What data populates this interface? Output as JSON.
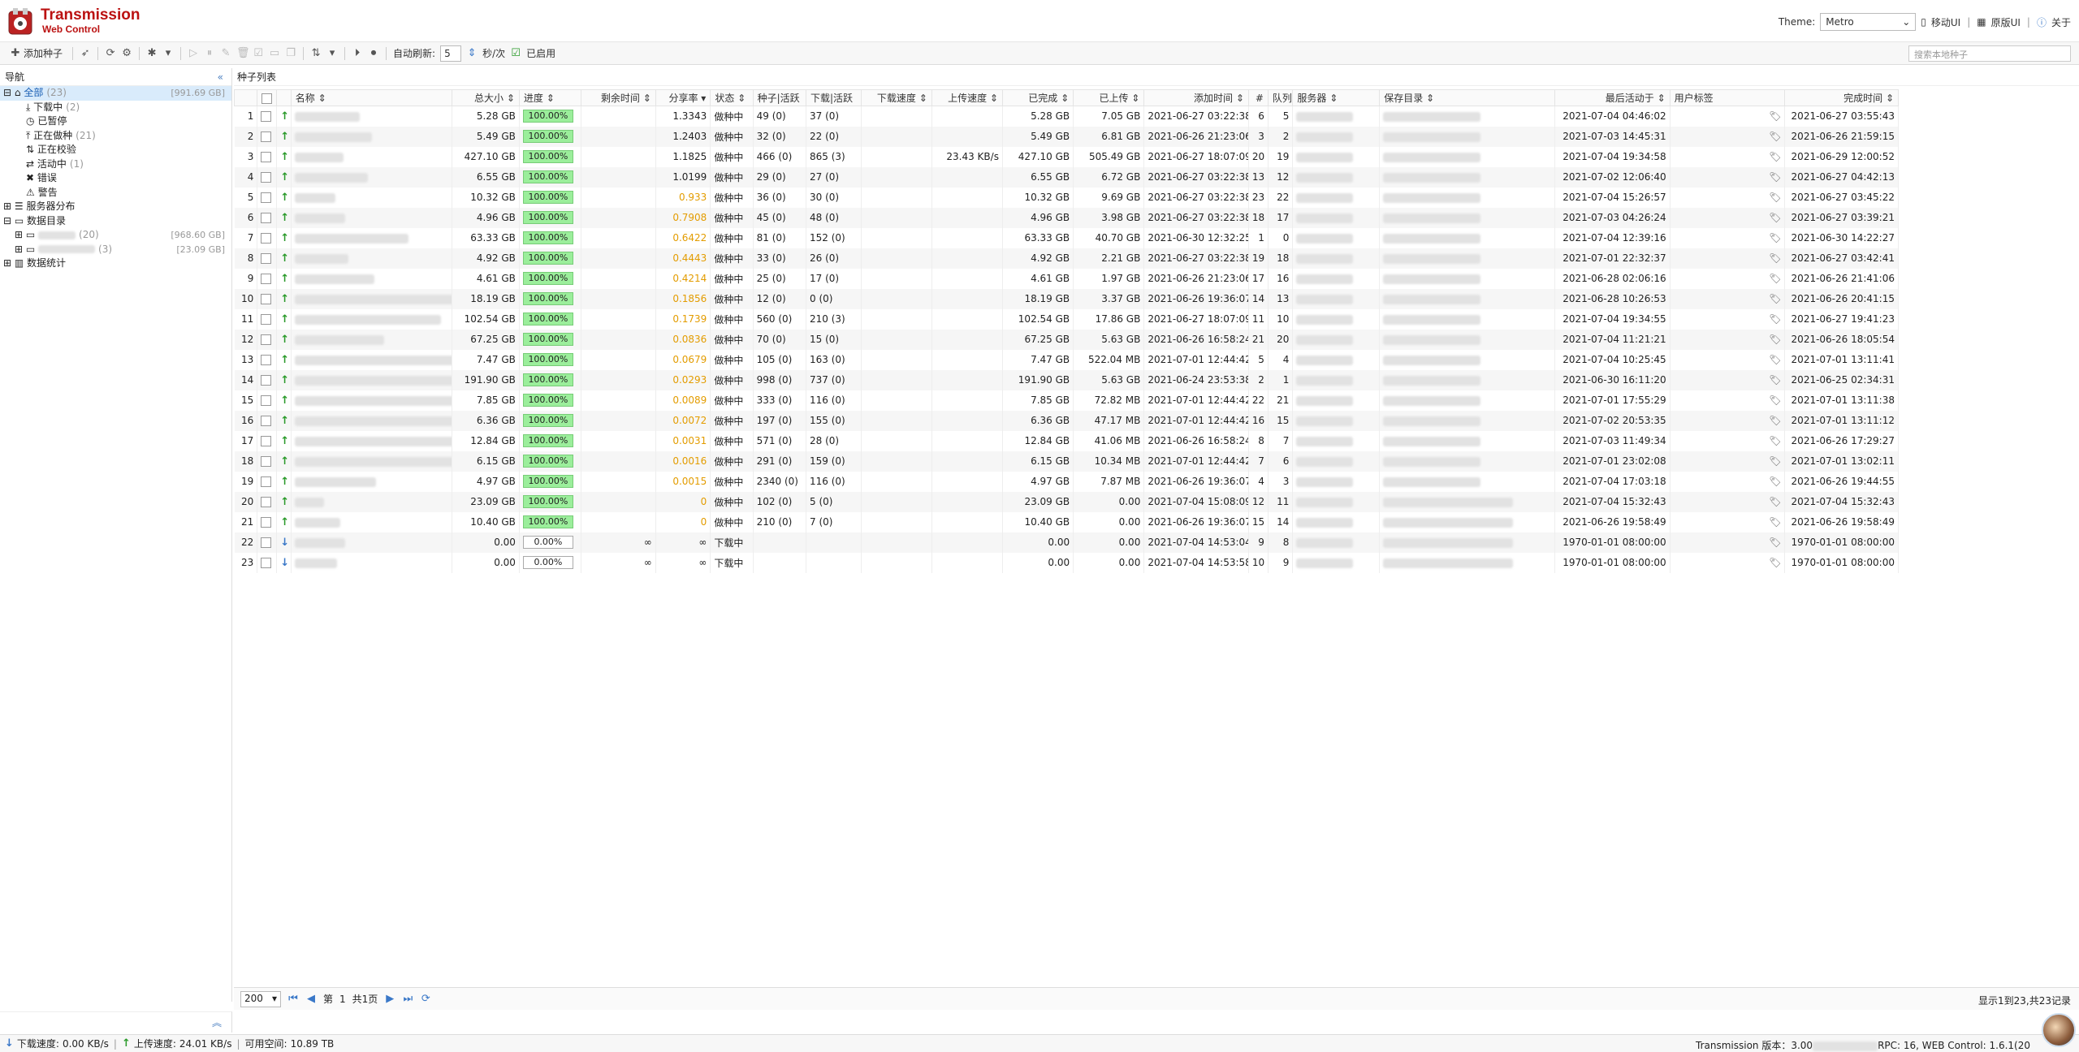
{
  "header": {
    "brand_line1": "Transmission",
    "brand_line2": "Web Control",
    "theme_label": "Theme:",
    "theme_value": "Metro",
    "mobile_ui": "移动UI",
    "original_ui": "原版UI",
    "about": "关于"
  },
  "toolbar": {
    "add_torrent": "添加种子",
    "auto_refresh": "自动刷新:",
    "refresh_interval": "5",
    "interval_unit": "秒/次",
    "enabled": "已启用",
    "search_placeholder": "搜索本地种子"
  },
  "nav": {
    "title": "导航",
    "items": [
      {
        "label": "全部",
        "count": "(23)",
        "size": "[991.69 GB]"
      },
      {
        "label": "下载中",
        "count": "(2)"
      },
      {
        "label": "已暂停",
        "count": ""
      },
      {
        "label": "正在做种",
        "count": "(21)"
      },
      {
        "label": "正在校验",
        "count": ""
      },
      {
        "label": "活动中",
        "count": "(1)"
      },
      {
        "label": "错误",
        "count": ""
      },
      {
        "label": "警告",
        "count": ""
      },
      {
        "label": "服务器分布",
        "count": ""
      },
      {
        "label": "数据目录",
        "count": ""
      },
      {
        "label": "",
        "count": "(20)",
        "size": "[968.60 GB]"
      },
      {
        "label": "",
        "count": "(3)",
        "size": "[23.09 GB]"
      },
      {
        "label": "数据统计",
        "count": ""
      }
    ]
  },
  "list": {
    "title": "种子列表",
    "columns": [
      "名称",
      "总大小",
      "进度",
      "剩余时间",
      "分享率",
      "状态",
      "种子|活跃",
      "下载|活跃",
      "下载速度",
      "上传速度",
      "已完成",
      "已上传",
      "添加时间",
      "#",
      "队列",
      "服务器",
      "保存目录",
      "最后活动于",
      "用户标签",
      "完成时间"
    ],
    "rows": [
      {
        "n": "1",
        "size": "5.28 GB",
        "prog": "100.00%",
        "eta": "",
        "ratio": "1.3343",
        "st": "做种中",
        "seeds": "49 (0)",
        "peers": "37 (0)",
        "dl": "",
        "ul": "",
        "done": "5.28 GB",
        "up": "7.05 GB",
        "added": "2021-06-27 03:22:38",
        "idx": "6",
        "q": "5",
        "last": "2021-07-04 04:46:02",
        "fin": "2021-06-27 03:55:43"
      },
      {
        "n": "2",
        "size": "5.49 GB",
        "prog": "100.00%",
        "eta": "",
        "ratio": "1.2403",
        "st": "做种中",
        "seeds": "32 (0)",
        "peers": "22 (0)",
        "dl": "",
        "ul": "",
        "done": "5.49 GB",
        "up": "6.81 GB",
        "added": "2021-06-26 21:23:06",
        "idx": "3",
        "q": "2",
        "last": "2021-07-03 14:45:31",
        "fin": "2021-06-26 21:59:15"
      },
      {
        "n": "3",
        "size": "427.10 GB",
        "prog": "100.00%",
        "eta": "",
        "ratio": "1.1825",
        "st": "做种中",
        "seeds": "466 (0)",
        "peers": "865 (3)",
        "dl": "",
        "ul": "23.43 KB/s",
        "done": "427.10 GB",
        "up": "505.49 GB",
        "added": "2021-06-27 18:07:09",
        "idx": "20",
        "q": "19",
        "last": "2021-07-04 19:34:58",
        "fin": "2021-06-29 12:00:52"
      },
      {
        "n": "4",
        "size": "6.55 GB",
        "prog": "100.00%",
        "eta": "",
        "ratio": "1.0199",
        "st": "做种中",
        "seeds": "29 (0)",
        "peers": "27 (0)",
        "dl": "",
        "ul": "",
        "done": "6.55 GB",
        "up": "6.72 GB",
        "added": "2021-06-27 03:22:38",
        "idx": "13",
        "q": "12",
        "last": "2021-07-02 12:06:40",
        "fin": "2021-06-27 04:42:13"
      },
      {
        "n": "5",
        "size": "10.32 GB",
        "prog": "100.00%",
        "eta": "",
        "ratio": "0.933",
        "st": "做种中",
        "seeds": "36 (0)",
        "peers": "30 (0)",
        "dl": "",
        "ul": "",
        "done": "10.32 GB",
        "up": "9.69 GB",
        "added": "2021-06-27 03:22:38",
        "idx": "23",
        "q": "22",
        "last": "2021-07-04 15:26:57",
        "fin": "2021-06-27 03:45:22"
      },
      {
        "n": "6",
        "size": "4.96 GB",
        "prog": "100.00%",
        "eta": "",
        "ratio": "0.7908",
        "st": "做种中",
        "seeds": "45 (0)",
        "peers": "48 (0)",
        "dl": "",
        "ul": "",
        "done": "4.96 GB",
        "up": "3.98 GB",
        "added": "2021-06-27 03:22:38",
        "idx": "18",
        "q": "17",
        "last": "2021-07-03 04:26:24",
        "fin": "2021-06-27 03:39:21"
      },
      {
        "n": "7",
        "size": "63.33 GB",
        "prog": "100.00%",
        "eta": "",
        "ratio": "0.6422",
        "st": "做种中",
        "seeds": "81 (0)",
        "peers": "152 (0)",
        "dl": "",
        "ul": "",
        "done": "63.33 GB",
        "up": "40.70 GB",
        "added": "2021-06-30 12:32:25",
        "idx": "1",
        "q": "0",
        "last": "2021-07-04 12:39:16",
        "fin": "2021-06-30 14:22:27"
      },
      {
        "n": "8",
        "size": "4.92 GB",
        "prog": "100.00%",
        "eta": "",
        "ratio": "0.4443",
        "st": "做种中",
        "seeds": "33 (0)",
        "peers": "26 (0)",
        "dl": "",
        "ul": "",
        "done": "4.92 GB",
        "up": "2.21 GB",
        "added": "2021-06-27 03:22:38",
        "idx": "19",
        "q": "18",
        "last": "2021-07-01 22:32:37",
        "fin": "2021-06-27 03:42:41"
      },
      {
        "n": "9",
        "size": "4.61 GB",
        "prog": "100.00%",
        "eta": "",
        "ratio": "0.4214",
        "st": "做种中",
        "seeds": "25 (0)",
        "peers": "17 (0)",
        "dl": "",
        "ul": "",
        "done": "4.61 GB",
        "up": "1.97 GB",
        "added": "2021-06-26 21:23:06",
        "idx": "17",
        "q": "16",
        "last": "2021-06-28 02:06:16",
        "fin": "2021-06-26 21:41:06"
      },
      {
        "n": "10",
        "size": "18.19 GB",
        "prog": "100.00%",
        "eta": "",
        "ratio": "0.1856",
        "st": "做种中",
        "seeds": "12 (0)",
        "peers": "0 (0)",
        "dl": "",
        "ul": "",
        "done": "18.19 GB",
        "up": "3.37 GB",
        "added": "2021-06-26 19:36:07",
        "idx": "14",
        "q": "13",
        "last": "2021-06-28 10:26:53",
        "fin": "2021-06-26 20:41:15"
      },
      {
        "n": "11",
        "size": "102.54 GB",
        "prog": "100.00%",
        "eta": "",
        "ratio": "0.1739",
        "st": "做种中",
        "seeds": "560 (0)",
        "peers": "210 (3)",
        "dl": "",
        "ul": "",
        "done": "102.54 GB",
        "up": "17.86 GB",
        "added": "2021-06-27 18:07:09",
        "idx": "11",
        "q": "10",
        "last": "2021-07-04 19:34:55",
        "fin": "2021-06-27 19:41:23"
      },
      {
        "n": "12",
        "size": "67.25 GB",
        "prog": "100.00%",
        "eta": "",
        "ratio": "0.0836",
        "st": "做种中",
        "seeds": "70 (0)",
        "peers": "15 (0)",
        "dl": "",
        "ul": "",
        "done": "67.25 GB",
        "up": "5.63 GB",
        "added": "2021-06-26 16:58:24",
        "idx": "21",
        "q": "20",
        "last": "2021-07-04 11:21:21",
        "fin": "2021-06-26 18:05:54"
      },
      {
        "n": "13",
        "size": "7.47 GB",
        "prog": "100.00%",
        "eta": "",
        "ratio": "0.0679",
        "st": "做种中",
        "seeds": "105 (0)",
        "peers": "163 (0)",
        "dl": "",
        "ul": "",
        "done": "7.47 GB",
        "up": "522.04 MB",
        "added": "2021-07-01 12:44:42",
        "idx": "5",
        "q": "4",
        "last": "2021-07-04 10:25:45",
        "fin": "2021-07-01 13:11:41"
      },
      {
        "n": "14",
        "size": "191.90 GB",
        "prog": "100.00%",
        "eta": "",
        "ratio": "0.0293",
        "st": "做种中",
        "seeds": "998 (0)",
        "peers": "737 (0)",
        "dl": "",
        "ul": "",
        "done": "191.90 GB",
        "up": "5.63 GB",
        "added": "2021-06-24 23:53:38",
        "idx": "2",
        "q": "1",
        "last": "2021-06-30 16:11:20",
        "fin": "2021-06-25 02:34:31"
      },
      {
        "n": "15",
        "size": "7.85 GB",
        "prog": "100.00%",
        "eta": "",
        "ratio": "0.0089",
        "st": "做种中",
        "seeds": "333 (0)",
        "peers": "116 (0)",
        "dl": "",
        "ul": "",
        "done": "7.85 GB",
        "up": "72.82 MB",
        "added": "2021-07-01 12:44:42",
        "idx": "22",
        "q": "21",
        "last": "2021-07-01 17:55:29",
        "fin": "2021-07-01 13:11:38"
      },
      {
        "n": "16",
        "size": "6.36 GB",
        "prog": "100.00%",
        "eta": "",
        "ratio": "0.0072",
        "st": "做种中",
        "seeds": "197 (0)",
        "peers": "155 (0)",
        "dl": "",
        "ul": "",
        "done": "6.36 GB",
        "up": "47.17 MB",
        "added": "2021-07-01 12:44:42",
        "idx": "16",
        "q": "15",
        "last": "2021-07-02 20:53:35",
        "fin": "2021-07-01 13:11:12"
      },
      {
        "n": "17",
        "size": "12.84 GB",
        "prog": "100.00%",
        "eta": "",
        "ratio": "0.0031",
        "st": "做种中",
        "seeds": "571 (0)",
        "peers": "28 (0)",
        "dl": "",
        "ul": "",
        "done": "12.84 GB",
        "up": "41.06 MB",
        "added": "2021-06-26 16:58:24",
        "idx": "8",
        "q": "7",
        "last": "2021-07-03 11:49:34",
        "fin": "2021-06-26 17:29:27"
      },
      {
        "n": "18",
        "size": "6.15 GB",
        "prog": "100.00%",
        "eta": "",
        "ratio": "0.0016",
        "st": "做种中",
        "seeds": "291 (0)",
        "peers": "159 (0)",
        "dl": "",
        "ul": "",
        "done": "6.15 GB",
        "up": "10.34 MB",
        "added": "2021-07-01 12:44:42",
        "idx": "7",
        "q": "6",
        "last": "2021-07-01 23:02:08",
        "fin": "2021-07-01 13:02:11"
      },
      {
        "n": "19",
        "size": "4.97 GB",
        "prog": "100.00%",
        "eta": "",
        "ratio": "0.0015",
        "st": "做种中",
        "seeds": "2340 (0)",
        "peers": "116 (0)",
        "dl": "",
        "ul": "",
        "done": "4.97 GB",
        "up": "7.87 MB",
        "added": "2021-06-26 19:36:07",
        "idx": "4",
        "q": "3",
        "last": "2021-07-04 17:03:18",
        "fin": "2021-06-26 19:44:55"
      },
      {
        "n": "20",
        "size": "23.09 GB",
        "prog": "100.00%",
        "eta": "",
        "ratio": "0",
        "st": "做种中",
        "seeds": "102 (0)",
        "peers": "5 (0)",
        "dl": "",
        "ul": "",
        "done": "23.09 GB",
        "up": "0.00",
        "added": "2021-07-04 15:08:09",
        "idx": "12",
        "q": "11",
        "last": "2021-07-04 15:32:43",
        "fin": "2021-07-04 15:32:43"
      },
      {
        "n": "21",
        "size": "10.40 GB",
        "prog": "100.00%",
        "eta": "",
        "ratio": "0",
        "st": "做种中",
        "seeds": "210 (0)",
        "peers": "7 (0)",
        "dl": "",
        "ul": "",
        "done": "10.40 GB",
        "up": "0.00",
        "added": "2021-06-26 19:36:07",
        "idx": "15",
        "q": "14",
        "last": "2021-06-26 19:58:49",
        "fin": "2021-06-26 19:58:49"
      },
      {
        "n": "22",
        "size": "0.00",
        "prog": "0.00%",
        "eta": "∞",
        "ratio": "∞",
        "st": "下载中",
        "seeds": "",
        "peers": "",
        "dl": "",
        "ul": "",
        "done": "0.00",
        "up": "0.00",
        "added": "2021-07-04 14:53:04",
        "idx": "9",
        "q": "8",
        "last": "1970-01-01 08:00:00",
        "fin": "1970-01-01 08:00:00"
      },
      {
        "n": "23",
        "size": "0.00",
        "prog": "0.00%",
        "eta": "∞",
        "ratio": "∞",
        "st": "下载中",
        "seeds": "",
        "peers": "",
        "dl": "",
        "ul": "",
        "done": "0.00",
        "up": "0.00",
        "added": "2021-07-04 14:53:58",
        "idx": "10",
        "q": "9",
        "last": "1970-01-01 08:00:00",
        "fin": "1970-01-01 08:00:00"
      }
    ]
  },
  "pager": {
    "page_size": "200",
    "page_prefix": "第",
    "page_num": "1",
    "page_total": "共1页",
    "info": "显示1到23,共23记录"
  },
  "status": {
    "dl_label": "下载速度:",
    "dl_value": "0.00 KB/s",
    "ul_label": "上传速度:",
    "ul_value": "24.01 KB/s",
    "free_label": "可用空间:",
    "free_value": "10.89 TB",
    "version_prefix": "Transmission 版本：3.00",
    "version_suffix": "RPC: 16, WEB Control: 1.6.1(20"
  }
}
